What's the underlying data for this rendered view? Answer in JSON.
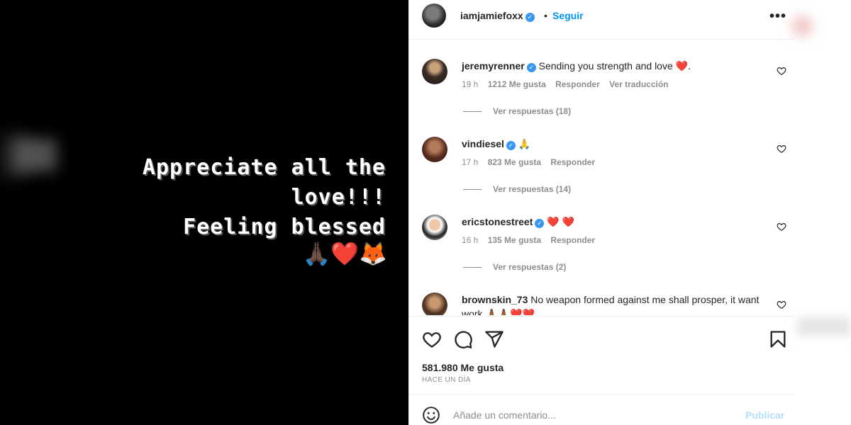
{
  "post": {
    "media": {
      "text": "Appreciate all the\nlove!!!\nFeeling blessed",
      "emoji": "🙏🏿❤️🦊"
    },
    "header": {
      "username": "iamjamiefoxx",
      "separator": "•",
      "follow_label": "Seguir"
    },
    "comments": [
      {
        "username": "jeremyrenner",
        "text": "Sending you strength and love",
        "emoji": "❤️",
        "suffix": ".",
        "time": "19 h",
        "likes": "1212 Me gusta",
        "reply_label": "Responder",
        "translate_label": "Ver traducción",
        "view_replies": "Ver respuestas (18)"
      },
      {
        "username": "vindiesel",
        "text": "",
        "emoji": "🙏",
        "suffix": "",
        "time": "17 h",
        "likes": "823 Me gusta",
        "reply_label": "Responder",
        "view_replies": "Ver respuestas (14)"
      },
      {
        "username": "ericstonestreet",
        "text": "",
        "emoji": "❤️ ❤️",
        "suffix": "",
        "time": "16 h",
        "likes": "135 Me gusta",
        "reply_label": "Responder",
        "view_replies": "Ver respuestas (2)"
      },
      {
        "username": "brownskin_73",
        "text": "No weapon formed against me shall prosper, it want work",
        "emoji": "🙏🏾🙏🏾❤️❤️",
        "suffix": ""
      }
    ],
    "likes_count": "581.980 Me gusta",
    "posted": "HACE UN DÍA",
    "add_comment_placeholder": "Añade un comentario...",
    "publish_label": "Publicar",
    "icons": {
      "like": "heart-outline-icon",
      "comment": "comment-bubble-icon",
      "share": "paper-plane-icon",
      "save": "bookmark-icon",
      "emoji": "smiley-icon",
      "more": "more-options-icon",
      "verified": "verified-badge-icon"
    },
    "colors": {
      "follow": "#0095f6",
      "verified": "#3897f0",
      "publish_disabled": "#b2dffc",
      "heart": "#ed4956"
    }
  }
}
